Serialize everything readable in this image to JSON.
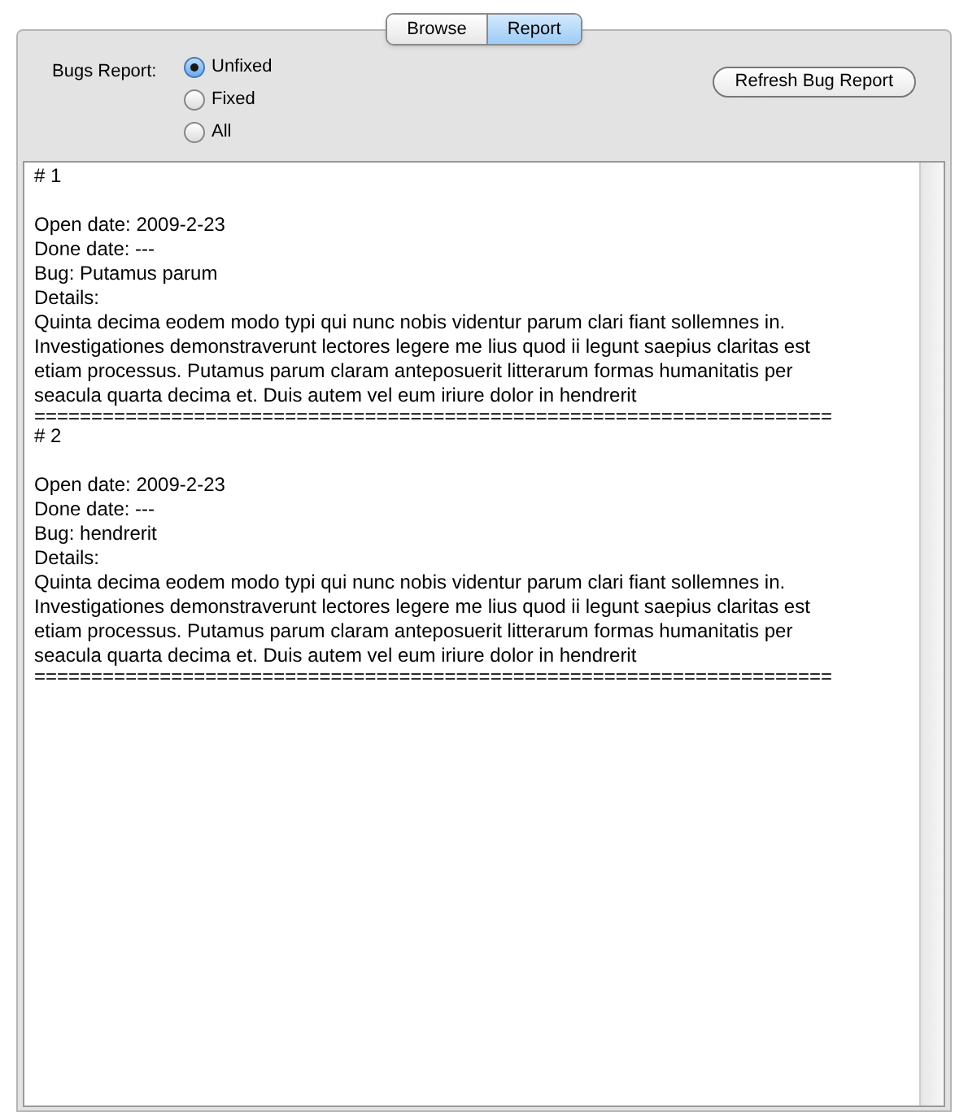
{
  "tabs": [
    {
      "label": "Browse",
      "selected": false
    },
    {
      "label": "Report",
      "selected": true
    }
  ],
  "filter": {
    "label": "Bugs Report:",
    "options": [
      {
        "label": "Unfixed",
        "selected": true
      },
      {
        "label": "Fixed",
        "selected": false
      },
      {
        "label": "All",
        "selected": false
      }
    ]
  },
  "refresh_button": "Refresh Bug Report",
  "report": [
    {
      "number": "# 1",
      "open_date": "Open date: 2009-2-23",
      "done_date": "Done date: ---",
      "bug": "Bug: Putamus parum",
      "details_label": "Details:",
      "details": "Quinta decima eodem modo typi qui nunc nobis videntur parum clari fiant sollemnes in. Investigationes demonstraverunt lectores legere me lius quod ii legunt saepius claritas est etiam processus. Putamus parum claram anteposuerit litterarum formas humanitatis per seacula quarta decima et. Duis autem vel eum iriure dolor in hendrerit",
      "separator": "======================================================================"
    },
    {
      "number": "# 2",
      "open_date": "Open date: 2009-2-23",
      "done_date": "Done date: ---",
      "bug": "Bug: hendrerit",
      "details_label": "Details:",
      "details": "Quinta decima eodem modo typi qui nunc nobis videntur parum clari fiant sollemnes in. Investigationes demonstraverunt lectores legere me lius quod ii legunt saepius claritas est etiam processus. Putamus parum claram anteposuerit litterarum formas humanitatis per seacula quarta decima et. Duis autem vel eum iriure dolor in hendrerit",
      "separator": "======================================================================"
    }
  ]
}
